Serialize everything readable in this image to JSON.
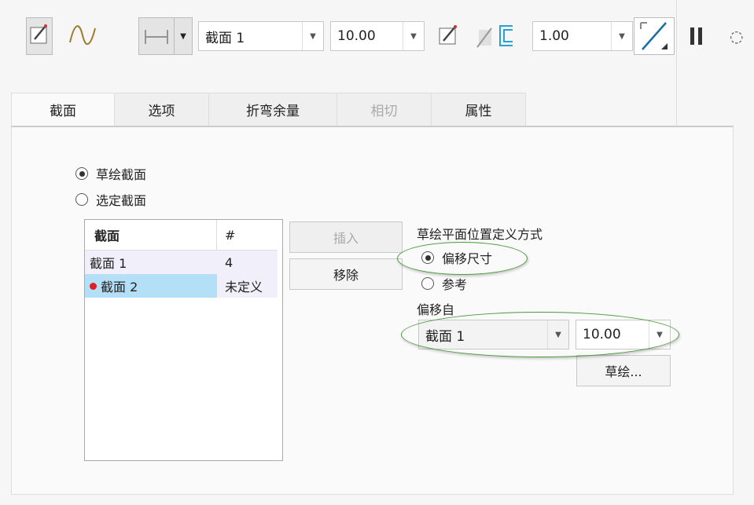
{
  "toolbar": {
    "section_combo": "截面 1",
    "depth_combo": "10.00",
    "thickness_combo": "1.00"
  },
  "tabs": [
    {
      "label": "截面"
    },
    {
      "label": "选项"
    },
    {
      "label": "折弯余量"
    },
    {
      "label": "相切"
    },
    {
      "label": "属性"
    }
  ],
  "panel": {
    "radio_sketch": "草绘截面",
    "radio_select": "选定截面",
    "table": {
      "headers": [
        "截面",
        "#"
      ],
      "rows": [
        {
          "name": "截面 1",
          "num": "4"
        },
        {
          "name": "截面 2",
          "num": "未定义"
        }
      ]
    },
    "insert": "插入",
    "remove": "移除",
    "plane_label": "草绘平面位置定义方式",
    "radio_offset": "偏移尺寸",
    "radio_ref": "参考",
    "offset_from_label": "偏移自",
    "offset_from": "截面 1",
    "offset_value": "10.00",
    "sketch_button": "草绘..."
  },
  "colors": {
    "accent_green": "#4a9a3a",
    "selection": "#b3e0f7",
    "error_dot": "#e02020"
  }
}
